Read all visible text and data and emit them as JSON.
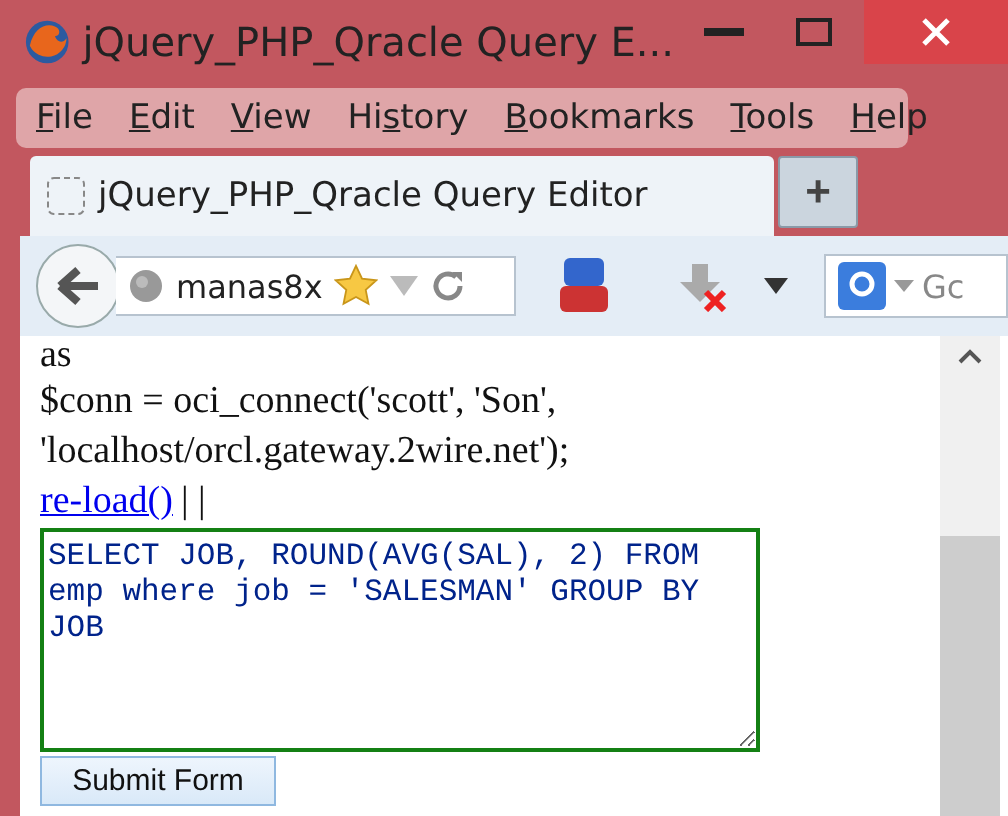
{
  "window": {
    "title": "jQuery_PHP_Qracle Query E..."
  },
  "menu": [
    {
      "key": "F",
      "rest": "ile"
    },
    {
      "key": "E",
      "rest": "dit"
    },
    {
      "key": "V",
      "rest": "iew"
    },
    {
      "lead": "Hi",
      "key": "s",
      "rest": "tory"
    },
    {
      "key": "B",
      "rest": "ookmarks"
    },
    {
      "key": "T",
      "rest": "ools"
    },
    {
      "key": "H",
      "rest": "elp"
    }
  ],
  "tabs": [
    {
      "label": "jQuery_PHP_Qracle Query Editor",
      "selected": true
    }
  ],
  "new_tab": {
    "label": "+"
  },
  "address": {
    "value": "manas8x"
  },
  "search": {
    "value": "Gc"
  },
  "content": {
    "lines": [
      "as",
      "$conn = oci_connect('scott', 'Son',",
      "'localhost/orcl.gateway.2wire.net');"
    ],
    "link": "re-load()",
    "separator": "| |",
    "query": "SELECT JOB, ROUND(AVG(SAL), 2) FROM emp where job = 'SALESMAN' GROUP BY JOB ",
    "submit": "Submit Form"
  }
}
